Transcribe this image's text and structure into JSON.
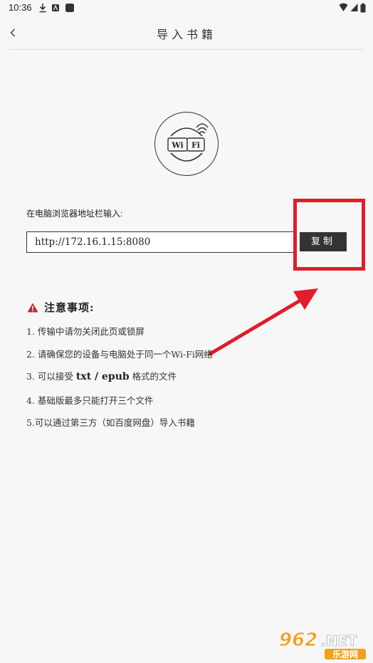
{
  "status": {
    "time": "10:36"
  },
  "header": {
    "title": "导入书籍"
  },
  "wifi_badge": {
    "left": "Wi",
    "right": "Fi"
  },
  "import": {
    "instruction": "在电脑浏览器地址栏输入:",
    "url": "http://172.16.1.15:8080",
    "copy_label": "复制"
  },
  "notice": {
    "title": "注意事项:",
    "items": [
      "1. 传输中请勿关闭此页或锁屏",
      "2. 请确保您的设备与电脑处于同一个Wi-Fi网络",
      {
        "prefix": "3. 可以接受 ",
        "formats": "txt / epub",
        "suffix": " 格式的文件"
      },
      "4. 基础版最多只能打开三个文件",
      "5.可以通过第三方（如百度网盘）导入书籍"
    ]
  },
  "watermark": {
    "brand": "962.NET",
    "sub": "乐游网"
  },
  "colors": {
    "annotation": "#e31b2a",
    "button": "#333333",
    "warning": "#c0272d"
  }
}
